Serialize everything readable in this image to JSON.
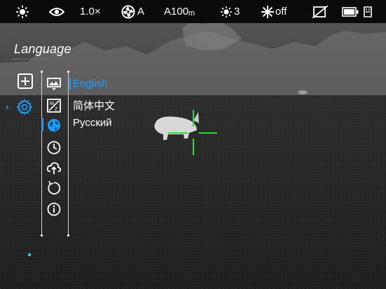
{
  "status_bar": {
    "brightness_icon": "sun-icon",
    "visibility_icon": "eye-icon",
    "zoom": "1.0×",
    "calibration_icon": "shutter-icon",
    "calibration_mode": "A",
    "amplification": "A100",
    "amplification_unit": "m",
    "contrast_icon": "sun-icon",
    "contrast_level": "3",
    "wifi_icon": "snowflake-icon",
    "wifi_state": "off",
    "display_off_icon": "display-slash-icon",
    "battery_icon": "battery-icon",
    "storage_icon": "sd-card-icon"
  },
  "menu": {
    "title": "Language",
    "main_items": [
      {
        "icon": "plus-square-icon"
      },
      {
        "icon": "gear-icon",
        "selected": true
      }
    ],
    "sub_items": [
      {
        "icon": "image-mode-icon"
      },
      {
        "icon": "ab-pattern-icon"
      },
      {
        "icon": "globe-icon",
        "selected": true
      },
      {
        "icon": "clock-icon"
      },
      {
        "icon": "cloud-upload-icon"
      },
      {
        "icon": "reset-icon"
      },
      {
        "icon": "info-icon"
      }
    ],
    "languages": [
      {
        "label": "English",
        "active": true
      },
      {
        "label": "简体中文",
        "active": false
      },
      {
        "label": "Русский",
        "active": false
      }
    ]
  },
  "colors": {
    "accent": "#1aa0ff",
    "reticle": "#22dd33",
    "status_bg": "#0b0b0b"
  }
}
